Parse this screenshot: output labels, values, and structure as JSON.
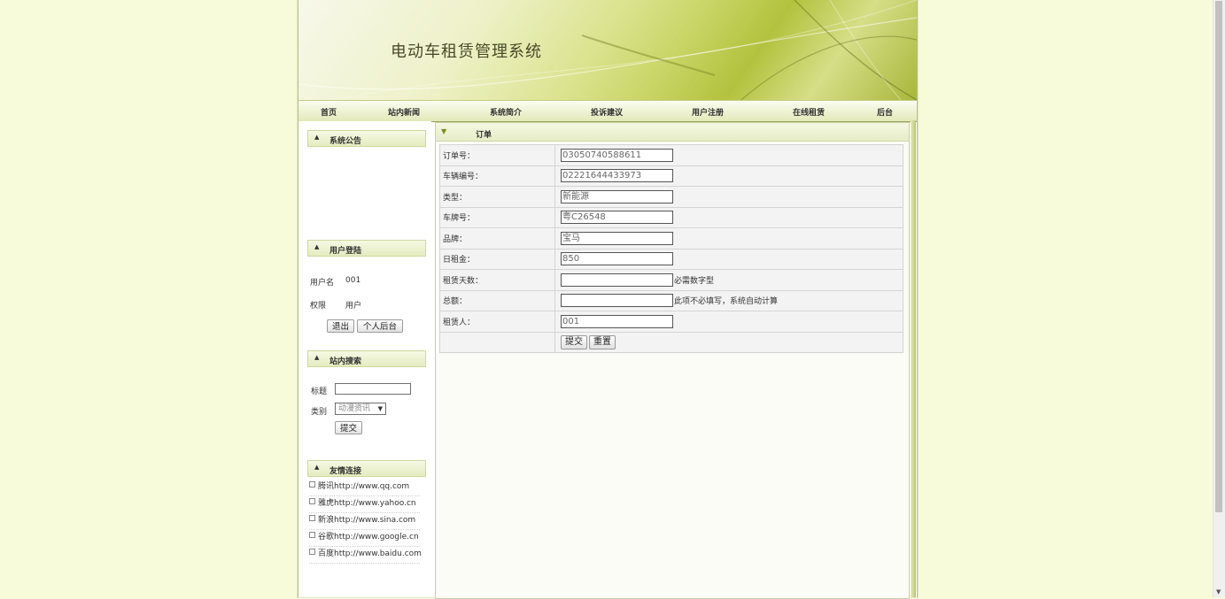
{
  "app": {
    "title": "电动车租赁管理系统"
  },
  "nav": [
    {
      "label": "首页"
    },
    {
      "label": "站内新闻"
    },
    {
      "label": "系统简介"
    },
    {
      "label": "投诉建议"
    },
    {
      "label": "用户注册"
    },
    {
      "label": "在线租赁"
    },
    {
      "label": "后台"
    }
  ],
  "sidebar": {
    "announcement_title": "系统公告",
    "login": {
      "title": "用户登陆",
      "username_label": "用户名",
      "username_value": "001",
      "role_label": "权限",
      "role_value": "用户",
      "logout_label": "退出",
      "personal_label": "个人后台"
    },
    "search": {
      "title": "站内搜索",
      "title_label": "标题",
      "title_value": "",
      "category_label": "类别",
      "category_value": "动漫资讯",
      "submit_label": "提交"
    },
    "links": {
      "title": "友情连接",
      "items": [
        {
          "label": "腾讯http://www.qq.com"
        },
        {
          "label": "雅虎http://www.yahoo.cn"
        },
        {
          "label": "新浪http://www.sina.com"
        },
        {
          "label": "谷歌http://www.google.cn"
        },
        {
          "label": "百度http://www.baidu.com"
        }
      ]
    }
  },
  "main": {
    "title": "订单",
    "fields": [
      {
        "label": "订单号：",
        "value": "03050740588611",
        "hint": ""
      },
      {
        "label": "车辆编号：",
        "value": "02221644433973",
        "hint": ""
      },
      {
        "label": "类型：",
        "value": "新能源",
        "hint": ""
      },
      {
        "label": "车牌号：",
        "value": "粤C26548",
        "hint": ""
      },
      {
        "label": "品牌：",
        "value": "宝马",
        "hint": ""
      },
      {
        "label": "日租金：",
        "value": "850",
        "hint": ""
      },
      {
        "label": "租赁天数：",
        "value": "",
        "hint": "必需数字型"
      },
      {
        "label": "总额：",
        "value": "",
        "hint": "此项不必填写，系统自动计算"
      },
      {
        "label": "租赁人：",
        "value": "001",
        "hint": ""
      }
    ],
    "submit_label": "提交",
    "reset_label": "重置"
  }
}
